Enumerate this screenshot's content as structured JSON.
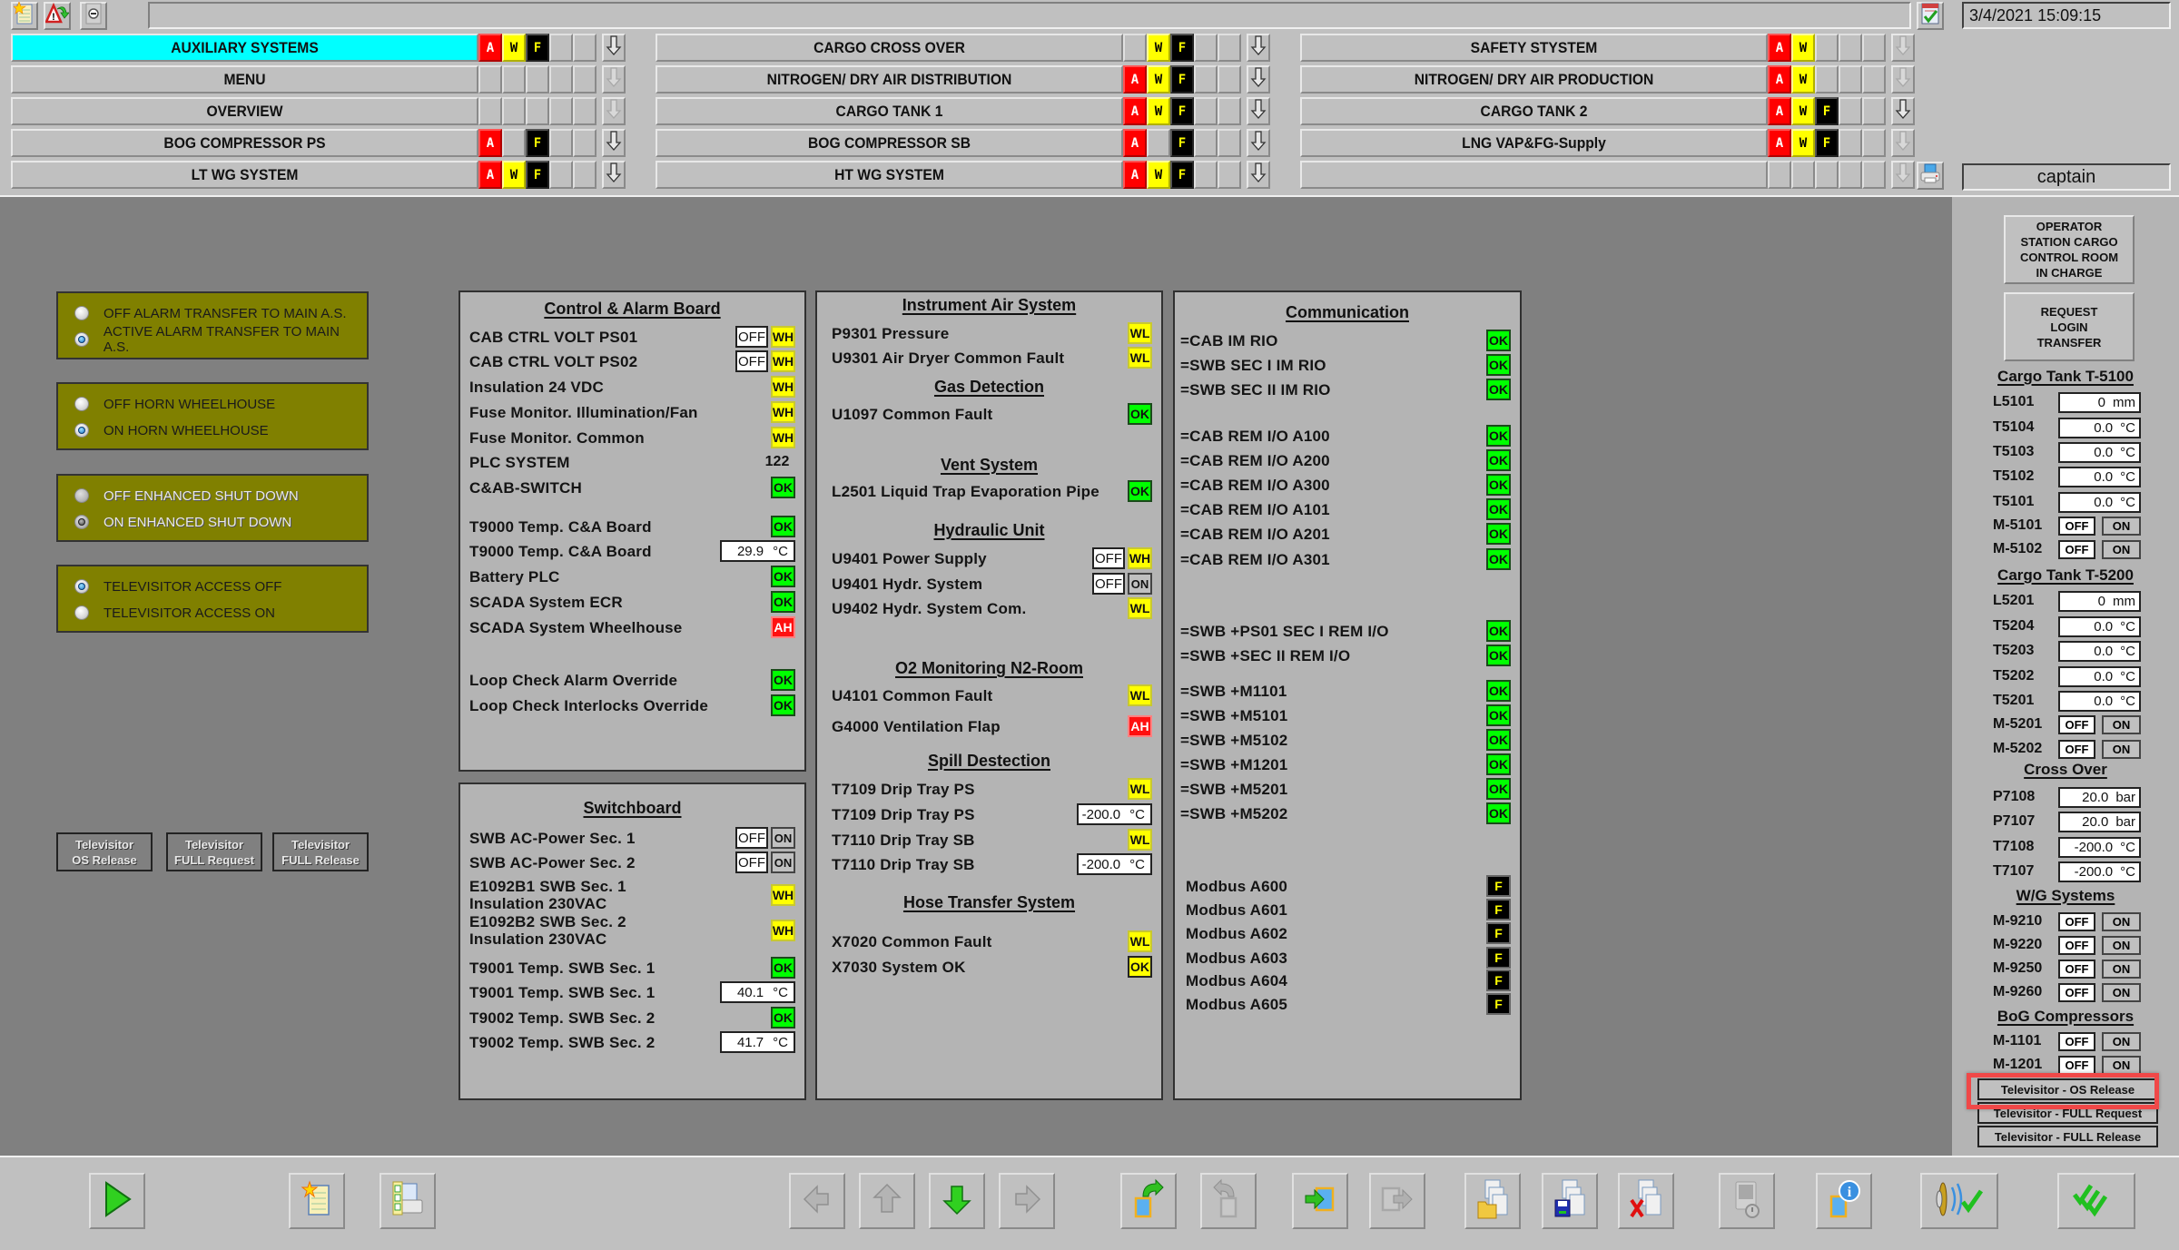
{
  "header": {
    "title_field": "",
    "datetime": "3/4/2021 15:09:15",
    "user": "captain",
    "top_icons": [
      "new-sheet-icon",
      "alarm-acknowledge-icon",
      "minimize-icon"
    ],
    "nav_columns": [
      [
        {
          "label": "AUXILIARY SYSTEMS",
          "active": true,
          "alarms": [
            "A",
            "W",
            "F",
            "",
            ""
          ],
          "arrow_enabled": true
        },
        {
          "label": "MENU",
          "active": false,
          "alarms": [
            "",
            "",
            "",
            "",
            ""
          ],
          "arrow_enabled": false
        },
        {
          "label": "OVERVIEW",
          "active": false,
          "alarms": [
            "",
            "",
            "",
            "",
            ""
          ],
          "arrow_enabled": false
        },
        {
          "label": "BOG COMPRESSOR PS",
          "active": false,
          "alarms": [
            "A",
            "",
            "F",
            "",
            ""
          ],
          "arrow_enabled": true
        },
        {
          "label": "LT WG SYSTEM",
          "active": false,
          "alarms": [
            "A",
            "W",
            "F",
            "",
            ""
          ],
          "arrow_enabled": true
        }
      ],
      [
        {
          "label": "CARGO CROSS OVER",
          "active": false,
          "alarms": [
            "",
            "W",
            "F",
            "",
            ""
          ],
          "arrow_enabled": true
        },
        {
          "label": "NITROGEN/ DRY AIR DISTRIBUTION",
          "active": false,
          "alarms": [
            "A",
            "W",
            "F",
            "",
            ""
          ],
          "arrow_enabled": true
        },
        {
          "label": "CARGO TANK 1",
          "active": false,
          "alarms": [
            "A",
            "W",
            "F",
            "",
            ""
          ],
          "arrow_enabled": true
        },
        {
          "label": "BOG COMPRESSOR SB",
          "active": false,
          "alarms": [
            "A",
            "",
            "F",
            "",
            ""
          ],
          "arrow_enabled": true
        },
        {
          "label": "HT WG SYSTEM",
          "active": false,
          "alarms": [
            "A",
            "W",
            "F",
            "",
            ""
          ],
          "arrow_enabled": true
        }
      ],
      [
        {
          "label": "SAFETY STYSTEM",
          "active": false,
          "alarms": [
            "A",
            "W",
            "",
            "",
            ""
          ],
          "arrow_enabled": false
        },
        {
          "label": "NITROGEN/ DRY AIR PRODUCTION",
          "active": false,
          "alarms": [
            "A",
            "W",
            "",
            "",
            ""
          ],
          "arrow_enabled": false
        },
        {
          "label": "CARGO TANK 2",
          "active": false,
          "alarms": [
            "A",
            "W",
            "F",
            "",
            ""
          ],
          "arrow_enabled": true
        },
        {
          "label": "LNG VAP&FG-Supply",
          "active": false,
          "alarms": [
            "A",
            "W",
            "F",
            "",
            ""
          ],
          "arrow_enabled": false
        },
        {
          "label": "",
          "active": false,
          "alarms": [
            "",
            "",
            "",
            "",
            ""
          ],
          "arrow_enabled": false
        }
      ]
    ]
  },
  "left_controls": {
    "radio_groups": [
      {
        "options": [
          {
            "label": "OFF ALARM TRANSFER TO MAIN A.S.",
            "selected": false
          },
          {
            "label": "ACTIVE  ALARM TRANSFER TO MAIN A.S.",
            "selected": true
          }
        ],
        "disabled": false
      },
      {
        "options": [
          {
            "label": "OFF HORN WHEELHOUSE",
            "selected": false
          },
          {
            "label": "ON HORN WHEELHOUSE",
            "selected": true
          }
        ],
        "disabled": false
      },
      {
        "options": [
          {
            "label": "OFF ENHANCED SHUT DOWN",
            "selected": false
          },
          {
            "label": "ON   ENHANCED SHUT DOWN",
            "selected": true
          }
        ],
        "disabled": true
      },
      {
        "options": [
          {
            "label": "TELEVISITOR ACCESS OFF",
            "selected": true
          },
          {
            "label": "TELEVISITOR ACCESS ON",
            "selected": false
          }
        ],
        "disabled": false
      }
    ],
    "televisitor_buttons": [
      {
        "line1": "Televisitor",
        "line2": "OS Release"
      },
      {
        "line1": "Televisitor",
        "line2": "FULL Request"
      },
      {
        "line1": "Televisitor",
        "line2": "FULL Release"
      }
    ]
  },
  "panels": {
    "control_alarm_board": {
      "title": "Control & Alarm Board",
      "rows": [
        {
          "label": "CAB CTRL VOLT PS01",
          "off": "OFF",
          "status": "WH"
        },
        {
          "label": "CAB CTRL VOLT PS02",
          "off": "OFF",
          "status": "WH"
        },
        {
          "label": "Insulation 24 VDC",
          "status": "WH"
        },
        {
          "label": "Fuse Monitor. Illumination/Fan",
          "status": "WH"
        },
        {
          "label": "Fuse Monitor. Common",
          "status": "WH"
        },
        {
          "label": "PLC SYSTEM",
          "number": "122"
        },
        {
          "label": "C&AB-SWITCH",
          "status": "OK"
        },
        {
          "label": "T9000 Temp. C&A Board",
          "status": "OK"
        },
        {
          "label": "T9000 Temp. C&A Board",
          "value": "29.9",
          "unit": "°C"
        },
        {
          "label": "Battery PLC",
          "status": "OK"
        },
        {
          "label": "SCADA System ECR",
          "status": "OK"
        },
        {
          "label": "SCADA System Wheelhouse",
          "status": "AH"
        },
        {
          "label": "Loop Check Alarm Override",
          "status": "OK"
        },
        {
          "label": "Loop Check Interlocks Override",
          "status": "OK"
        }
      ]
    },
    "switchboard": {
      "title": "Switchboard",
      "rows": [
        {
          "label": "SWB AC-Power Sec. 1",
          "off": "OFF",
          "on": "ON"
        },
        {
          "label": "SWB AC-Power Sec. 2",
          "off": "OFF",
          "on": "ON"
        },
        {
          "label": "E1092B1 SWB Sec. 1",
          "label2": "Insulation 230VAC",
          "status": "WH"
        },
        {
          "label": "E1092B2 SWB Sec. 2",
          "label2": "Insulation 230VAC",
          "status": "WH"
        },
        {
          "label": "T9001 Temp. SWB Sec. 1",
          "status": "OK"
        },
        {
          "label": "T9001 Temp. SWB Sec. 1",
          "value": "40.1",
          "unit": "°C"
        },
        {
          "label": "T9002 Temp. SWB Sec. 2",
          "status": "OK"
        },
        {
          "label": "T9002 Temp. SWB Sec. 2",
          "value": "41.7",
          "unit": "°C"
        }
      ]
    },
    "middle": {
      "sections": [
        {
          "title": "Instrument Air System",
          "rows": [
            {
              "label": "P9301 Pressure",
              "status": "WL"
            },
            {
              "label": "U9301 Air Dryer Common Fault",
              "status": "WL"
            }
          ]
        },
        {
          "title": "Gas Detection",
          "rows": [
            {
              "label": "U1097 Common Fault",
              "status": "OK"
            }
          ]
        },
        {
          "title": "Vent System",
          "rows": [
            {
              "label": "L2501 Liquid Trap Evaporation Pipe",
              "status": "OK"
            }
          ]
        },
        {
          "title": "Hydraulic Unit",
          "rows": [
            {
              "label": "U9401 Power Supply",
              "off": "OFF",
              "status": "WH"
            },
            {
              "label": "U9401 Hydr. System",
              "off": "OFF",
              "on": "ON"
            },
            {
              "label": "U9402 Hydr. System Com.",
              "status": "WL"
            }
          ]
        },
        {
          "title": "O2 Monitoring N2-Room",
          "rows": [
            {
              "label": "U4101 Common Fault",
              "status": "WL"
            },
            {
              "label": "G4000 Ventilation Flap",
              "status": "AH"
            }
          ]
        },
        {
          "title": "Spill Destection",
          "rows": [
            {
              "label": "T7109 Drip Tray PS",
              "status": "WL"
            },
            {
              "label": "T7109 Drip Tray PS",
              "value": "-200.0",
              "unit": "°C"
            },
            {
              "label": "T7110 Drip Tray SB",
              "status": "WL"
            },
            {
              "label": "T7110 Drip Tray SB",
              "value": "-200.0",
              "unit": "°C"
            }
          ]
        },
        {
          "title": "Hose Transfer System",
          "rows": [
            {
              "label": "X7020 Common Fault",
              "status": "WL"
            },
            {
              "label": "X7030 System OK",
              "status": "OK",
              "yellow": true
            }
          ]
        }
      ]
    },
    "communication": {
      "title": "Communication",
      "rows": [
        {
          "label": "=CAB IM RIO",
          "status": "OK"
        },
        {
          "label": "=SWB SEC I IM RIO",
          "status": "OK"
        },
        {
          "label": "=SWB SEC II IM RIO",
          "status": "OK"
        },
        {
          "label": "=CAB REM I/O A100",
          "status": "OK"
        },
        {
          "label": "=CAB REM I/O A200",
          "status": "OK"
        },
        {
          "label": "=CAB REM I/O A300",
          "status": "OK"
        },
        {
          "label": "=CAB REM I/O A101",
          "status": "OK"
        },
        {
          "label": "=CAB REM I/O A201",
          "status": "OK"
        },
        {
          "label": "=CAB REM I/O A301",
          "status": "OK"
        },
        {
          "label": "=SWB +PS01 SEC I REM I/O",
          "status": "OK"
        },
        {
          "label": "=SWB +SEC II REM I/O",
          "status": "OK"
        },
        {
          "label": "=SWB +M1101",
          "status": "OK"
        },
        {
          "label": "=SWB +M5101",
          "status": "OK"
        },
        {
          "label": "=SWB +M5102",
          "status": "OK"
        },
        {
          "label": "=SWB +M1201",
          "status": "OK"
        },
        {
          "label": "=SWB +M5201",
          "status": "OK"
        },
        {
          "label": "=SWB +M5202",
          "status": "OK"
        },
        {
          "label": "Modbus A600",
          "status": "F"
        },
        {
          "label": "Modbus A601",
          "status": "F"
        },
        {
          "label": "Modbus A602",
          "status": "F"
        },
        {
          "label": "Modbus A603",
          "status": "F"
        },
        {
          "label": "Modbus A604",
          "status": "F"
        },
        {
          "label": "Modbus A605",
          "status": "F"
        }
      ]
    }
  },
  "sidebar": {
    "operator_button": [
      "OPERATOR",
      "STATION CARGO",
      "CONTROL ROOM",
      "IN CHARGE"
    ],
    "request_button": [
      "REQUEST",
      "LOGIN",
      "TRANSFER"
    ],
    "sections": [
      {
        "title": "Cargo Tank T-5100",
        "rows": [
          {
            "label": "L5101",
            "value": "0",
            "unit": "mm"
          },
          {
            "label": "T5104",
            "value": "0.0",
            "unit": "°C"
          },
          {
            "label": "T5103",
            "value": "0.0",
            "unit": "°C"
          },
          {
            "label": "T5102",
            "value": "0.0",
            "unit": "°C"
          },
          {
            "label": "T5101",
            "value": "0.0",
            "unit": "°C"
          },
          {
            "label": "M-5101",
            "off": "OFF",
            "on": "ON"
          },
          {
            "label": "M-5102",
            "off": "OFF",
            "on": "ON"
          }
        ]
      },
      {
        "title": "Cargo Tank T-5200",
        "rows": [
          {
            "label": "L5201",
            "value": "0",
            "unit": "mm"
          },
          {
            "label": "T5204",
            "value": "0.0",
            "unit": "°C"
          },
          {
            "label": "T5203",
            "value": "0.0",
            "unit": "°C"
          },
          {
            "label": "T5202",
            "value": "0.0",
            "unit": "°C"
          },
          {
            "label": "T5201",
            "value": "0.0",
            "unit": "°C"
          },
          {
            "label": "M-5201",
            "off": "OFF",
            "on": "ON"
          },
          {
            "label": "M-5202",
            "off": "OFF",
            "on": "ON"
          }
        ]
      },
      {
        "title": "Cross Over",
        "rows": [
          {
            "label": "P7108",
            "value": "20.0",
            "unit": "bar"
          },
          {
            "label": "P7107",
            "value": "20.0",
            "unit": "bar"
          },
          {
            "label": "T7108",
            "value": "-200.0",
            "unit": "°C"
          },
          {
            "label": "T7107",
            "value": "-200.0",
            "unit": "°C"
          }
        ]
      },
      {
        "title": "W/G Systems",
        "rows": [
          {
            "label": "M-9210",
            "off": "OFF",
            "on": "ON"
          },
          {
            "label": "M-9220",
            "off": "OFF",
            "on": "ON"
          },
          {
            "label": "M-9250",
            "off": "OFF",
            "on": "ON"
          },
          {
            "label": "M-9260",
            "off": "OFF",
            "on": "ON"
          }
        ]
      },
      {
        "title": "BoG Compressors",
        "rows": [
          {
            "label": "M-1101",
            "off": "OFF",
            "on": "ON"
          },
          {
            "label": "M-1201",
            "off": "OFF",
            "on": "ON"
          }
        ]
      }
    ],
    "televisitor_buttons": [
      "Televisitor - OS Release",
      "Televisitor - FULL Request",
      "Televisitor - FULL Release"
    ],
    "highlighted_button": "Televisitor - OS Release"
  },
  "toolbar": {
    "buttons": [
      {
        "name": "play-icon",
        "enabled": true
      },
      {
        "name": "new-sheet-icon",
        "enabled": true
      },
      {
        "name": "print-preview-icon",
        "enabled": true
      },
      {
        "name": "arrow-left-icon",
        "enabled": false
      },
      {
        "name": "arrow-up-icon",
        "enabled": false
      },
      {
        "name": "arrow-down-icon",
        "enabled": true
      },
      {
        "name": "arrow-right-icon",
        "enabled": false
      },
      {
        "name": "back-page-icon",
        "enabled": true
      },
      {
        "name": "forward-page-icon",
        "enabled": false
      },
      {
        "name": "enter-page-icon",
        "enabled": false
      },
      {
        "name": "exit-page-icon",
        "enabled": false
      },
      {
        "name": "open-folder-icon",
        "enabled": true
      },
      {
        "name": "save-icon",
        "enabled": true
      },
      {
        "name": "delete-icon",
        "enabled": true
      },
      {
        "name": "monitor-settings-icon",
        "enabled": false
      },
      {
        "name": "info-icon",
        "enabled": true
      },
      {
        "name": "sound-acknowledge-icon",
        "enabled": true
      },
      {
        "name": "acknowledge-all-icon",
        "enabled": true
      }
    ]
  },
  "colors": {
    "alarm": "#ff0000",
    "warning": "#ffff00",
    "fault": "#000000",
    "ok": "#00ff00",
    "active_nav": "#00ffff",
    "radio_panel": "#808000",
    "highlight": "#f04848"
  }
}
